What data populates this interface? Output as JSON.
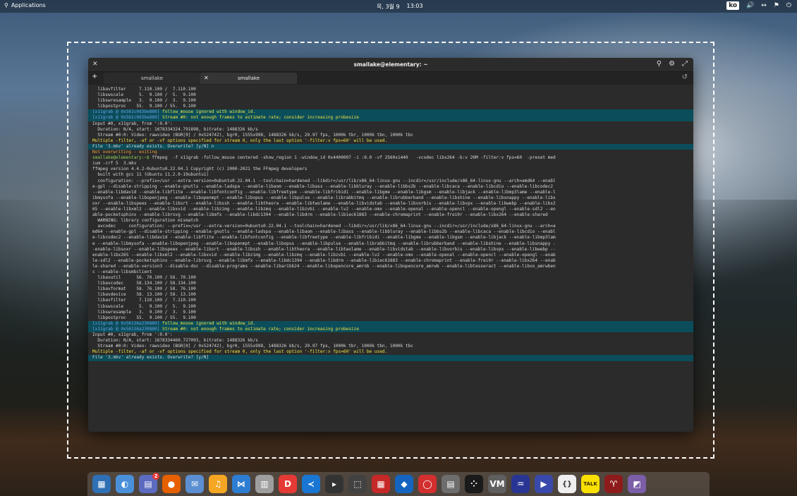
{
  "topbar": {
    "applications": "Applications",
    "date": "목, 3월 9",
    "time": "13:03",
    "lang": "ko"
  },
  "window": {
    "title": "smallake@elementary: ~",
    "tabs": [
      {
        "label": "smallake"
      },
      {
        "label": "smallake"
      }
    ]
  },
  "terminal_lines": [
    {
      "t": "  libavfilter     7.110.100 /  7.110.100",
      "c": "w"
    },
    {
      "t": "  libswscale      5.  9.100 /  5.  9.100",
      "c": "w"
    },
    {
      "t": "  libswresample   3.  9.100 /  3.  9.100",
      "c": "w"
    },
    {
      "t": "  libpostproc    55.  9.100 / 55.  9.100",
      "c": "w"
    },
    {
      "t": "[x11grab @ 0x561c0d3be880] follow_mouse ignored with window_id.",
      "c": "y",
      "h": true
    },
    {
      "t": "[x11grab @ 0x561c0d3be880] Stream #0: not enough frames to estimate rate; consider increasing probesize",
      "c": "y",
      "h": true
    },
    {
      "t": "Input #0, x11grab, from ':0.0':",
      "c": "w"
    },
    {
      "t": "  Duration: N/A, start: 1678334324.791898, bitrate: 1488326 kb/s",
      "c": "w"
    },
    {
      "t": "  Stream #0:0: Video: rawvideo (BGR[0] / 0x524742), bgr0, 1555x998, 1488326 kb/s, 29.97 fps, 1000k tbr, 1000k tbn, 1000k tbc",
      "c": "w"
    },
    {
      "t": "Multiple -filter, -af or -vf options specified for stream 0, only the last option '-filter:v fps=60' will be used.",
      "c": "y"
    },
    {
      "t": "File '3.mkv' already exists. Overwrite? [y/N] n",
      "c": "w",
      "h": true
    },
    {
      "t": "Not overwriting - exiting",
      "c": "o"
    },
    {
      "t": "smallake@elementary:~$ ffmpeg  -f x11grab -follow_mouse centered -show_region 1 -window_id 0x4400007 -i :0.0 -vf 2560x1440   -vcodec libx264 -b:v 20M -filter:v fps=60  -preset med",
      "c": "w",
      "p": true
    },
    {
      "t": "ium -crf 5  3.mkv",
      "c": "w"
    },
    {
      "t": "ffmpeg version 4.4.2-0ubuntu0.22.04.1 Copyright (c) 2000-2021 the FFmpeg developers",
      "c": "w"
    },
    {
      "t": "  built with gcc 11 (Ubuntu 11.2.0-19ubuntu1)",
      "c": "w"
    },
    {
      "t": "  configuration: --prefix=/usr --extra-version=0ubuntu0.22.04.1 --toolchain=hardened --libdir=/usr/lib/x86_64-linux-gnu --incdir=/usr/include/x86_64-linux-gnu --arch=amd64 --enabl",
      "c": "w"
    },
    {
      "t": "e-gpl --disable-stripping --enable-gnutls --enable-ladspa --enable-libaom --enable-libass --enable-libbluray --enable-libbs2b --enable-libcaca --enable-libcdio --enable-libcodec2",
      "c": "w"
    },
    {
      "t": "--enable-libdav1d --enable-libflite --enable-libfontconfig --enable-libfreetype --enable-libfribidi --enable-libgme --enable-libgsm --enable-libjack --enable-libmp3lame --enable-l",
      "c": "w"
    },
    {
      "t": "ibmysofa --enable-libopenjpeg --enable-libopenmpt --enable-libopus --enable-libpulse --enable-librabbitmq --enable-librubberband --enable-libshine --enable-libsnappy --enable-libs",
      "c": "w"
    },
    {
      "t": "oxr --enable-libspeex --enable-libsrt --enable-libssh --enable-libtheora --enable-libtwolame --enable-libvidstab --enable-libvorbis --enable-libvpx --enable-libwebp --enable-libx2",
      "c": "w"
    },
    {
      "t": "65 --enable-libxml2 --enable-libxvid --enable-libzimg --enable-libzmq --enable-libzvbi --enable-lv2 --enable-omx --enable-openal --enable-opencl --enable-opengl --enable-sdl2 --en",
      "c": "w"
    },
    {
      "t": "able-pocketsphinx --enable-librsvg --enable-libmfx --enable-libdc1394 --enable-libdrm --enable-libiec61883 --enable-chromaprint --enable-frei0r --enable-libx264 --enable-shared",
      "c": "w"
    },
    {
      "t": "  WARNING: library configuration mismatch",
      "c": "w"
    },
    {
      "t": "  avcodec     configuration: --prefix=/usr --extra-version=0ubuntu0.22.04.1 --toolchain=hardened --libdir=/usr/lib/x86_64-linux-gnu --incdir=/usr/include/x86_64-linux-gnu --arch=a",
      "c": "w"
    },
    {
      "t": "md64 --enable-gpl --disable-stripping --enable-gnutls --enable-ladspa --enable-libaom --enable-libass --enable-libbluray --enable-libbs2b --enable-libcaca --enable-libcdio --enabl",
      "c": "w"
    },
    {
      "t": "e-libcodec2 --enable-libdav1d --enable-libflite --enable-libfontconfig --enable-libfreetype --enable-libfribidi --enable-libgme --enable-libgsm --enable-libjack --enable-libmp3lam",
      "c": "w"
    },
    {
      "t": "e --enable-libmysofa --enable-libopenjpeg --enable-libopenmpt --enable-libopus --enable-libpulse --enable-librabbitmq --enable-librubberband --enable-libshine --enable-libsnappy -",
      "c": "w"
    },
    {
      "t": "-enable-libsoxr --enable-libspeex --enable-libsrt --enable-libssh --enable-libtheora --enable-libtwolame --enable-libvidstab --enable-libvorbis --enable-libvpx --enable-libwebp --",
      "c": "w"
    },
    {
      "t": "enable-libx265 --enable-libxml2 --enable-libxvid --enable-libzimg --enable-libzmq --enable-libzvbi --enable-lv2 --enable-omx --enable-openal --enable-opencl --enable-opengl --enab",
      "c": "w"
    },
    {
      "t": "le-sdl2 --enable-pocketsphinx --enable-librsvg --enable-libmfx --enable-libdc1394 --enable-libdrm --enable-libiec61883 --enable-chromaprint --enable-frei0r --enable-libx264 --enab",
      "c": "w"
    },
    {
      "t": "le-shared --enable-version3 --disable-doc --disable-programs --enable-libaribb24 --enable-libopencore_amrnb --enable-libopencore_amrwb --enable-libtesseract --enable-libvo_amrwben",
      "c": "w"
    },
    {
      "t": "c --enable-libsmbclient",
      "c": "w"
    },
    {
      "t": "  libavutil      56. 70.100 / 56. 70.100",
      "c": "w"
    },
    {
      "t": "  libavcodec     58.134.100 / 58.134.100",
      "c": "w"
    },
    {
      "t": "  libavformat    58. 76.100 / 58. 76.100",
      "c": "w"
    },
    {
      "t": "  libavdevice    58. 13.100 / 58. 13.100",
      "c": "w"
    },
    {
      "t": "  libavfilter     7.110.100 /  7.110.100",
      "c": "w"
    },
    {
      "t": "  libswscale      5.  9.100 /  5.  9.100",
      "c": "w"
    },
    {
      "t": "  libswresample   3.  9.100 /  3.  9.100",
      "c": "w"
    },
    {
      "t": "  libpostproc    55.  9.100 / 55.  9.100",
      "c": "w"
    },
    {
      "t": "[x11grab @ 0x56136a230880] follow_mouse ignored with window_id.",
      "c": "y",
      "h": true
    },
    {
      "t": "[x11grab @ 0x56136a230880] Stream #0: not enough frames to estimate rate; consider increasing probesize",
      "c": "y",
      "h": true
    },
    {
      "t": "Input #0, x11grab, from ':0.0':",
      "c": "w"
    },
    {
      "t": "  Duration: N/A, start: 1678334460.727093, bitrate: 1488326 kb/s",
      "c": "w"
    },
    {
      "t": "  Stream #0:0: Video: rawvideo (BGR[0] / 0x524742), bgr0, 1555x998, 1488326 kb/s, 29.97 fps, 1000k tbr, 1000k tbn, 1000k tbc",
      "c": "w"
    },
    {
      "t": "Multiple -filter, -af or -vf options specified for stream 0, only the last option '-filter:v fps=60' will be used.",
      "c": "y"
    },
    {
      "t": "File '3.mkv' already exists. Overwrite? [y/N] ",
      "c": "w",
      "h": true
    }
  ],
  "dock": [
    {
      "name": "multitasking-view-icon",
      "color": "#2f6fb3",
      "glyph": "▦"
    },
    {
      "name": "system-settings-icon",
      "color": "#4a90d9",
      "glyph": "◐"
    },
    {
      "name": "appcenter-icon",
      "color": "#5c6bc0",
      "glyph": "▤",
      "badge": "2"
    },
    {
      "name": "firefox-icon",
      "color": "#e66000",
      "glyph": "●"
    },
    {
      "name": "mail-icon",
      "color": "#5b8fd1",
      "glyph": "✉"
    },
    {
      "name": "music-icon",
      "color": "#f5a623",
      "glyph": "♫"
    },
    {
      "name": "vscode-like-icon",
      "color": "#2d7dd2",
      "glyph": "⋈"
    },
    {
      "name": "trash-icon",
      "color": "#9e9e9e",
      "glyph": "▥"
    },
    {
      "name": "app-red-icon",
      "color": "#e53935",
      "glyph": "D"
    },
    {
      "name": "visual-studio-code-icon",
      "color": "#1976d2",
      "glyph": "≺"
    },
    {
      "name": "terminal-icon",
      "color": "#333333",
      "glyph": "▸"
    },
    {
      "name": "screenshot-icon",
      "color": "#424242",
      "glyph": "⬚"
    },
    {
      "name": "app-grid-red-icon",
      "color": "#c62828",
      "glyph": "▦"
    },
    {
      "name": "drop-icon",
      "color": "#1565c0",
      "glyph": "◆"
    },
    {
      "name": "opera-icon",
      "color": "#d32f2f",
      "glyph": "◯"
    },
    {
      "name": "notes-icon",
      "color": "#6d6d6d",
      "glyph": "▤"
    },
    {
      "name": "dice-icon",
      "color": "#1a1a1a",
      "glyph": "⁘"
    },
    {
      "name": "vm-icon",
      "color": "#5f5f5f",
      "glyph": "VM"
    },
    {
      "name": "audio-icon",
      "color": "#283593",
      "glyph": "♒"
    },
    {
      "name": "video-icon",
      "color": "#3949ab",
      "glyph": "▶"
    },
    {
      "name": "code-braces-icon",
      "color": "#eeeeee",
      "glyph": "{}"
    },
    {
      "name": "kakaotalk-icon",
      "color": "#f9e000",
      "glyph": "T"
    },
    {
      "name": "wine-icon",
      "color": "#8e1b1b",
      "glyph": "♈"
    },
    {
      "name": "image-icon",
      "color": "#7b5ea7",
      "glyph": "◩"
    }
  ],
  "dock_talk_label": "TALK"
}
